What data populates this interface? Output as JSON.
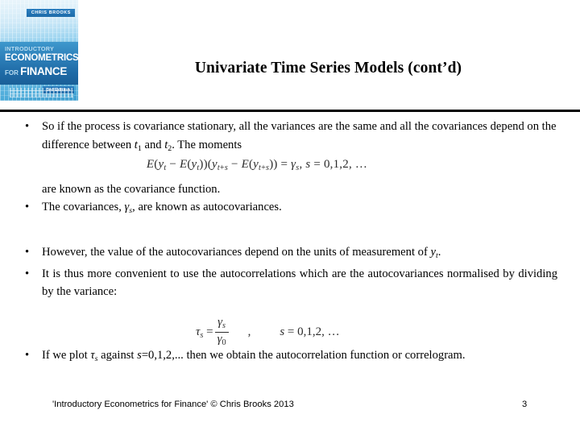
{
  "book_cover": {
    "author_badge": "CHRIS BROOKS",
    "title_line1": "INTRODUCTORY",
    "title_line2": "ECONOMETRICS",
    "title_line3_small": "FOR",
    "title_line3_big": "FINANCE",
    "edition_badge": "3rd Edition",
    "accent_color": "#2d7fb9",
    "background_color": "#8fcfee"
  },
  "slide": {
    "title": "Univariate Time Series Models (cont’d)",
    "divider_color": "#000000"
  },
  "bullets": [
    {
      "id": "covariance-stationary",
      "marker": "•",
      "text": "So if the process is covariance stationary, all the variances are the same and all the covariances depend on the difference between t1 and t2. The moments"
    },
    {
      "id": "autocovariances",
      "marker": "•",
      "text": "The covariances, γs, are known as autocovariances."
    },
    {
      "id": "units-of-measurement",
      "marker": "•",
      "text": "However, the value of the autocovariances depend on the units of measurement of yt."
    },
    {
      "id": "normalised-autocorrelations",
      "marker": "•",
      "text": "It is thus more convenient to use the autocorrelations which are the autocovariances normalised by dividing by the variance:"
    },
    {
      "id": "correlogram",
      "marker": "•",
      "text": "If we plot τs against s=0,1,2,... then we obtain the autocorrelation function or correlogram."
    }
  ],
  "continuation_text": "are known as the covariance function.",
  "equations": {
    "covariance_function": {
      "lhs": "E(yt − E(yt))(yt+s − E(yt+s))",
      "rhs": "γs",
      "condition": "s = 0,1,2, ...",
      "plain": "E(y_t − E(y_t))(y_{t+s} − E(y_{t+s})) = γ_s,  s = 0,1,2, ..."
    },
    "autocorrelation": {
      "lhs": "τs",
      "numerator": "γs",
      "denominator": "γ0",
      "separator": ",",
      "condition": "s = 0,1,2, ...",
      "plain": "τ_s = γ_s / γ0,  s = 0,1,2, ..."
    }
  },
  "footer": {
    "credit": "'Introductory Econometrics for Finance' © Chris Brooks 2013",
    "page_number": "3"
  }
}
